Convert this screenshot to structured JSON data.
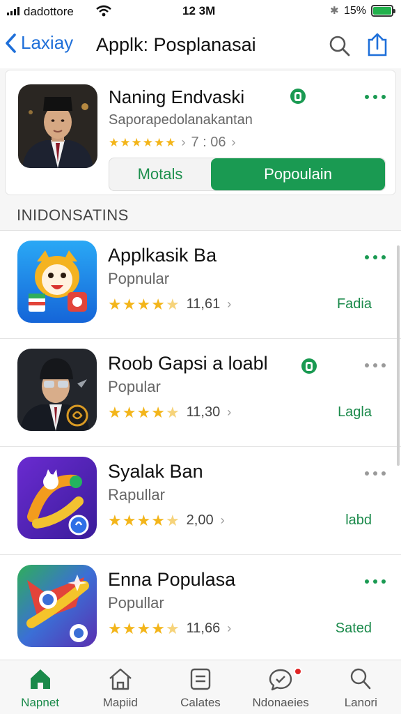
{
  "status_bar": {
    "carrier": "dadottore",
    "time": "12 3M",
    "battery": "15%"
  },
  "nav": {
    "back_label": "Laxiay",
    "title": "Applk: Posplanasai"
  },
  "featured": {
    "name": "Naning Endvaski",
    "subtitle": "Saporapedolanakantan",
    "rating_count": "7 : 06",
    "segment_left": "Motals",
    "segment_right": "Popoulain"
  },
  "section": {
    "header": "INIDONSATINS"
  },
  "apps": [
    {
      "name": "Applkasik Ba",
      "sub": "Popnular",
      "count": "11,61",
      "action": "Fadia",
      "stars": 4.5,
      "verified": false
    },
    {
      "name": "Roob Gapsi a loabl",
      "sub": "Popular",
      "count": "11,30",
      "action": "Lagla",
      "stars": 4.5,
      "verified": true
    },
    {
      "name": "Syalak Ban",
      "sub": "Rapullar",
      "count": "2,00",
      "action": "labd",
      "stars": 4.5,
      "verified": false
    },
    {
      "name": "Enna Populasa",
      "sub": "Popullar",
      "count": "11,66",
      "action": "Sated",
      "stars": 4.5,
      "verified": false
    }
  ],
  "tabs": [
    {
      "label": "Napnet",
      "icon": "home-icon"
    },
    {
      "label": "Mapiid",
      "icon": "house-outline-icon"
    },
    {
      "label": "Calates",
      "icon": "list-card-icon"
    },
    {
      "label": "Ndonaeies",
      "icon": "chat-bubble-icon"
    },
    {
      "label": "Lanori",
      "icon": "search-icon"
    }
  ],
  "colors": {
    "accent_green": "#1a9a52",
    "link_blue": "#1e6fd9",
    "star": "#f3b51a"
  }
}
